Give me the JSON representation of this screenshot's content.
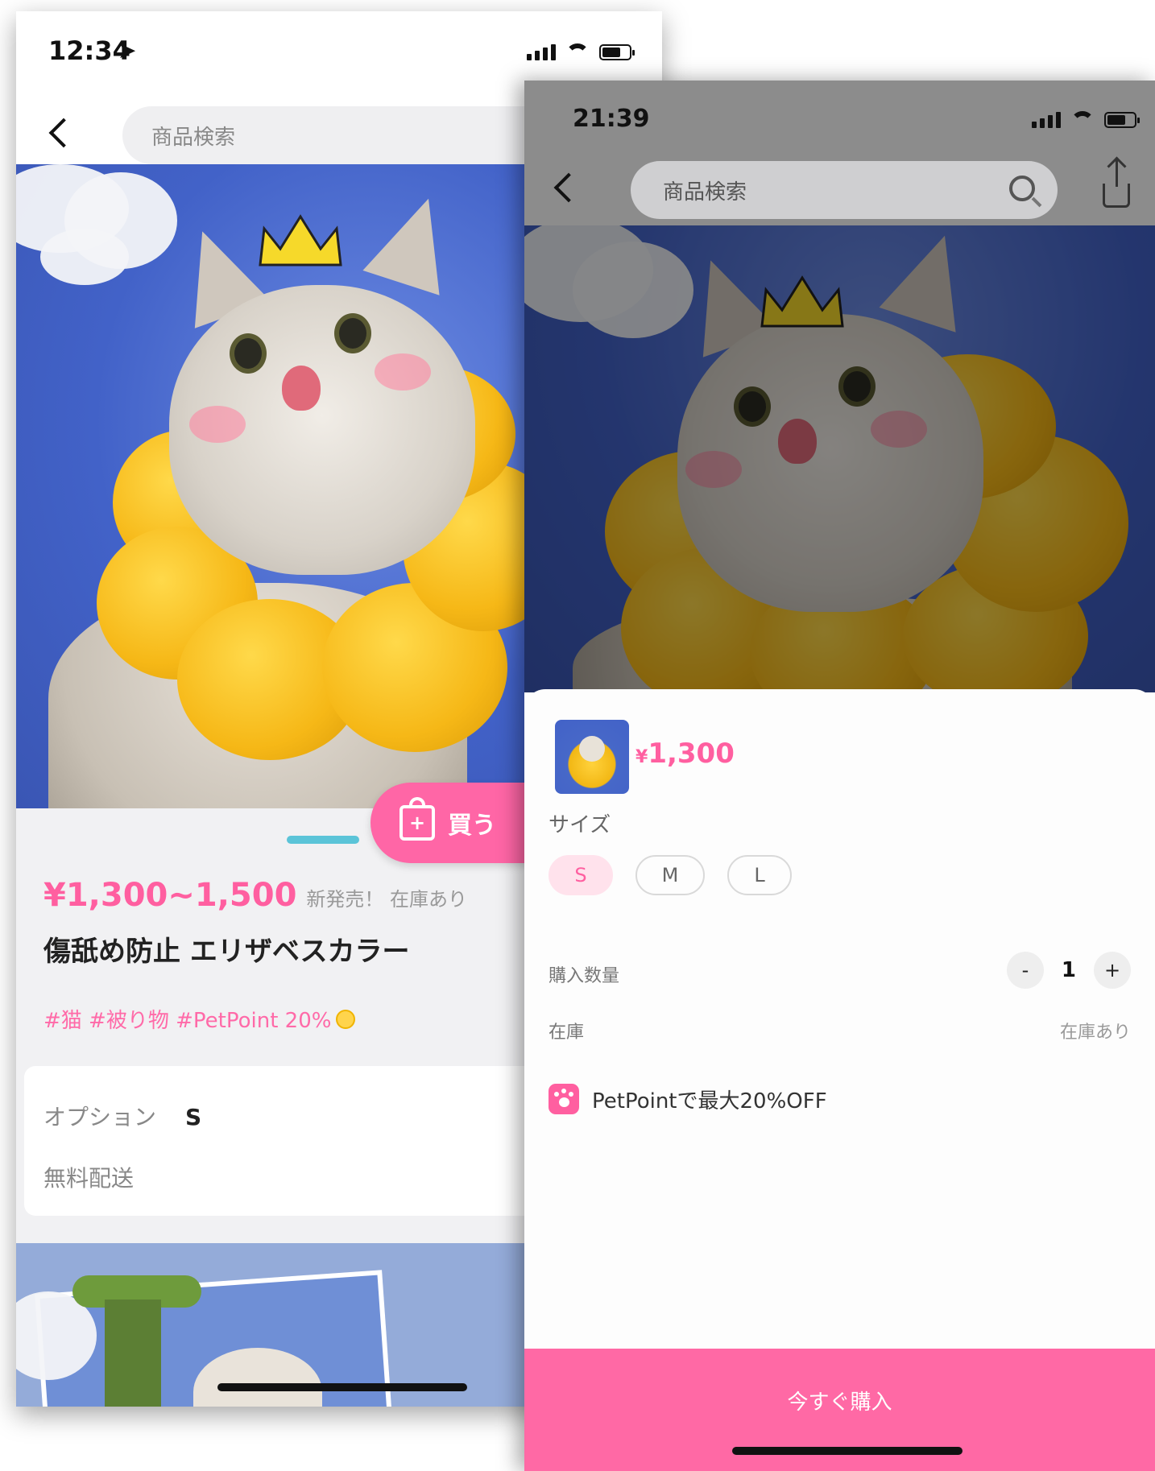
{
  "left_screen": {
    "status": {
      "time": "12:34"
    },
    "search": {
      "placeholder": "商品検索"
    },
    "buy_button_label": "買う",
    "product": {
      "price": "¥1,300~1,500",
      "meta": "新発売！ 在庫あり",
      "title": "傷舐め防止 エリザベスカラー",
      "tags": "#猫 #被り物 #PetPoint 20%"
    },
    "options": {
      "label": "オプション",
      "value": "S",
      "shipping": "無料配送"
    }
  },
  "right_screen": {
    "status": {
      "time": "21:39"
    },
    "search": {
      "placeholder": "商品検索"
    },
    "sheet": {
      "price_symbol": "¥",
      "price": "1,300",
      "size_label": "サイズ",
      "sizes": [
        "S",
        "M",
        "L"
      ],
      "selected_size": "S",
      "quantity_label": "購入数量",
      "quantity": "1",
      "minus": "-",
      "plus": "+",
      "stock_label": "在庫",
      "stock_value": "在庫あり",
      "petpoint_text": "PetPointで最大20%OFF"
    },
    "buy_now_label": "今すぐ購入"
  },
  "colors": {
    "accent_pink": "#ff66a6",
    "size_active_bg": "#ffe2ec",
    "sky_blue": "#4262c8"
  }
}
